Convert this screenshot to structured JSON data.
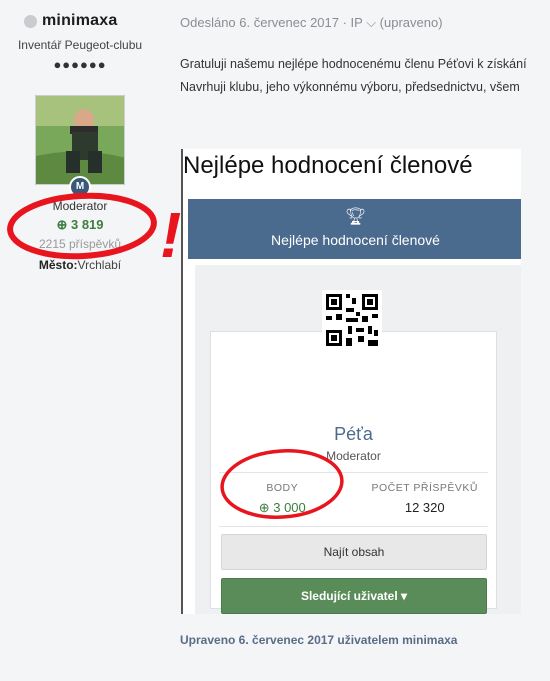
{
  "author": {
    "name": "minimaxa",
    "title": "Inventář Peugeot-clubu",
    "rank_pips": "●●●●●●",
    "group": "Moderator",
    "reputation": "3 819",
    "posts": "2215 příspěvků",
    "city_label": "Město:",
    "city_value": "Vrchlabí",
    "status_color": "#c9cbcf",
    "badge_icon": "moderator-shield-icon"
  },
  "post": {
    "meta": "Odesláno 6. červenec 2017 · IP ⌵ (upraveno)",
    "line1": "Gratuluji našemu nejlépe hodnocenému členu Péťovi k získání",
    "line2": "Navrhuji klubu, jeho výkonnému výboru, předsednictvu, všem",
    "edited": "Upraveno 6. červenec 2017 uživatelem minimaxa"
  },
  "embedded": {
    "heading": "Nejlépe hodnocení členové",
    "widget_title": "Nejlépe hodnocení členové",
    "widget_icon": "trophy-icon",
    "member_name": "Péťa",
    "member_role": "Moderator",
    "body_label": "BODY",
    "body_value": "3 000",
    "posts_label": "POČET PŘÍSPĚVKŮ",
    "posts_value": "12 320",
    "find_button": "Najít obsah",
    "follow_button": "Sledující uživatel ▾"
  },
  "annotation": {
    "exclamation": "!",
    "color": "#e8141e"
  },
  "colors": {
    "widget_header": "#4b6b8e",
    "reputation_green": "#3d7d3d",
    "follow_button": "#5a8c5a"
  }
}
